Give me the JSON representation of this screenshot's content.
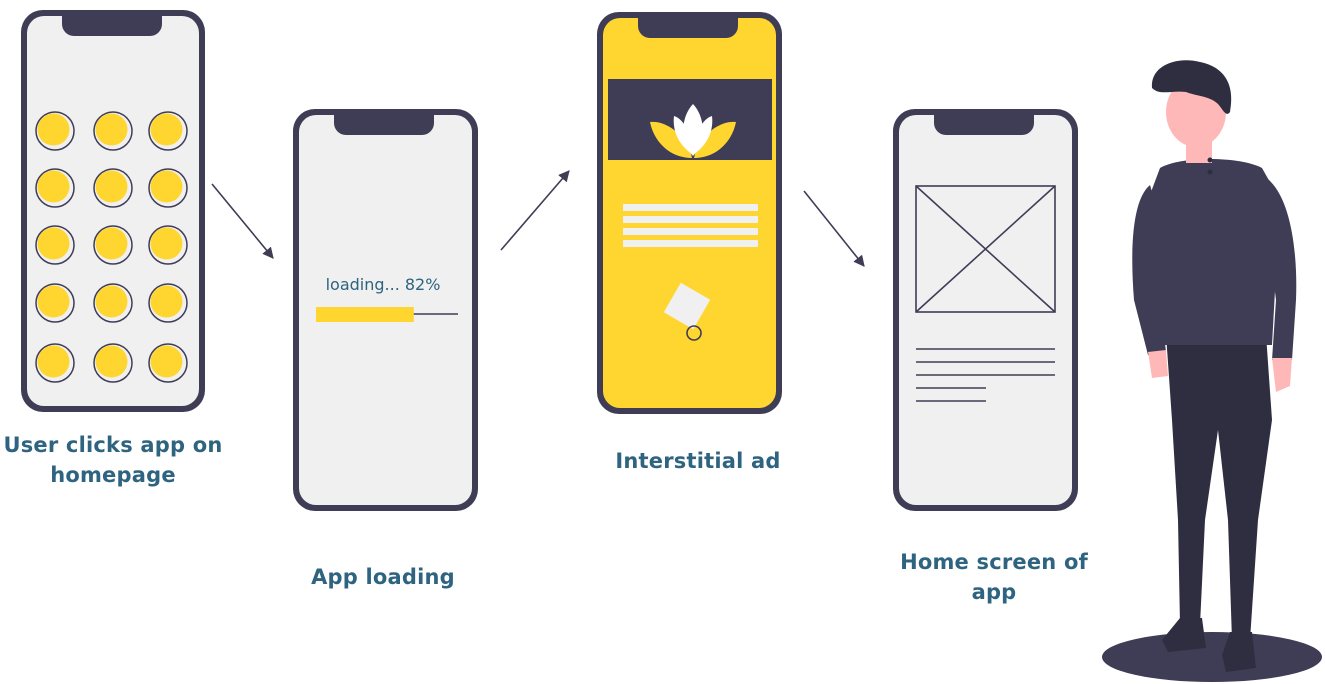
{
  "steps": [
    {
      "caption_lines": [
        "User clicks app on",
        "homepage"
      ]
    },
    {
      "caption_lines": [
        "App loading"
      ],
      "screen_text": "loading... 82%",
      "progress": 0.82
    },
    {
      "caption_lines": [
        "Interstitial ad"
      ]
    },
    {
      "caption_lines": [
        "Home screen of",
        "app"
      ]
    }
  ],
  "colors": {
    "phone_frame": "#3f3d56",
    "screen": "#f0f0f0",
    "accent_yellow": "#ffd630",
    "caption": "#2e6480",
    "person_dark": "#2f2e41",
    "person_shirt": "#3f3d56",
    "skin": "#ffb8b8",
    "white": "#ffffff"
  },
  "icons": [
    "app-icon-grid",
    "progress-bar",
    "lotus-logo-icon",
    "image-placeholder-icon",
    "flow-arrow-icon",
    "person-illustration"
  ]
}
